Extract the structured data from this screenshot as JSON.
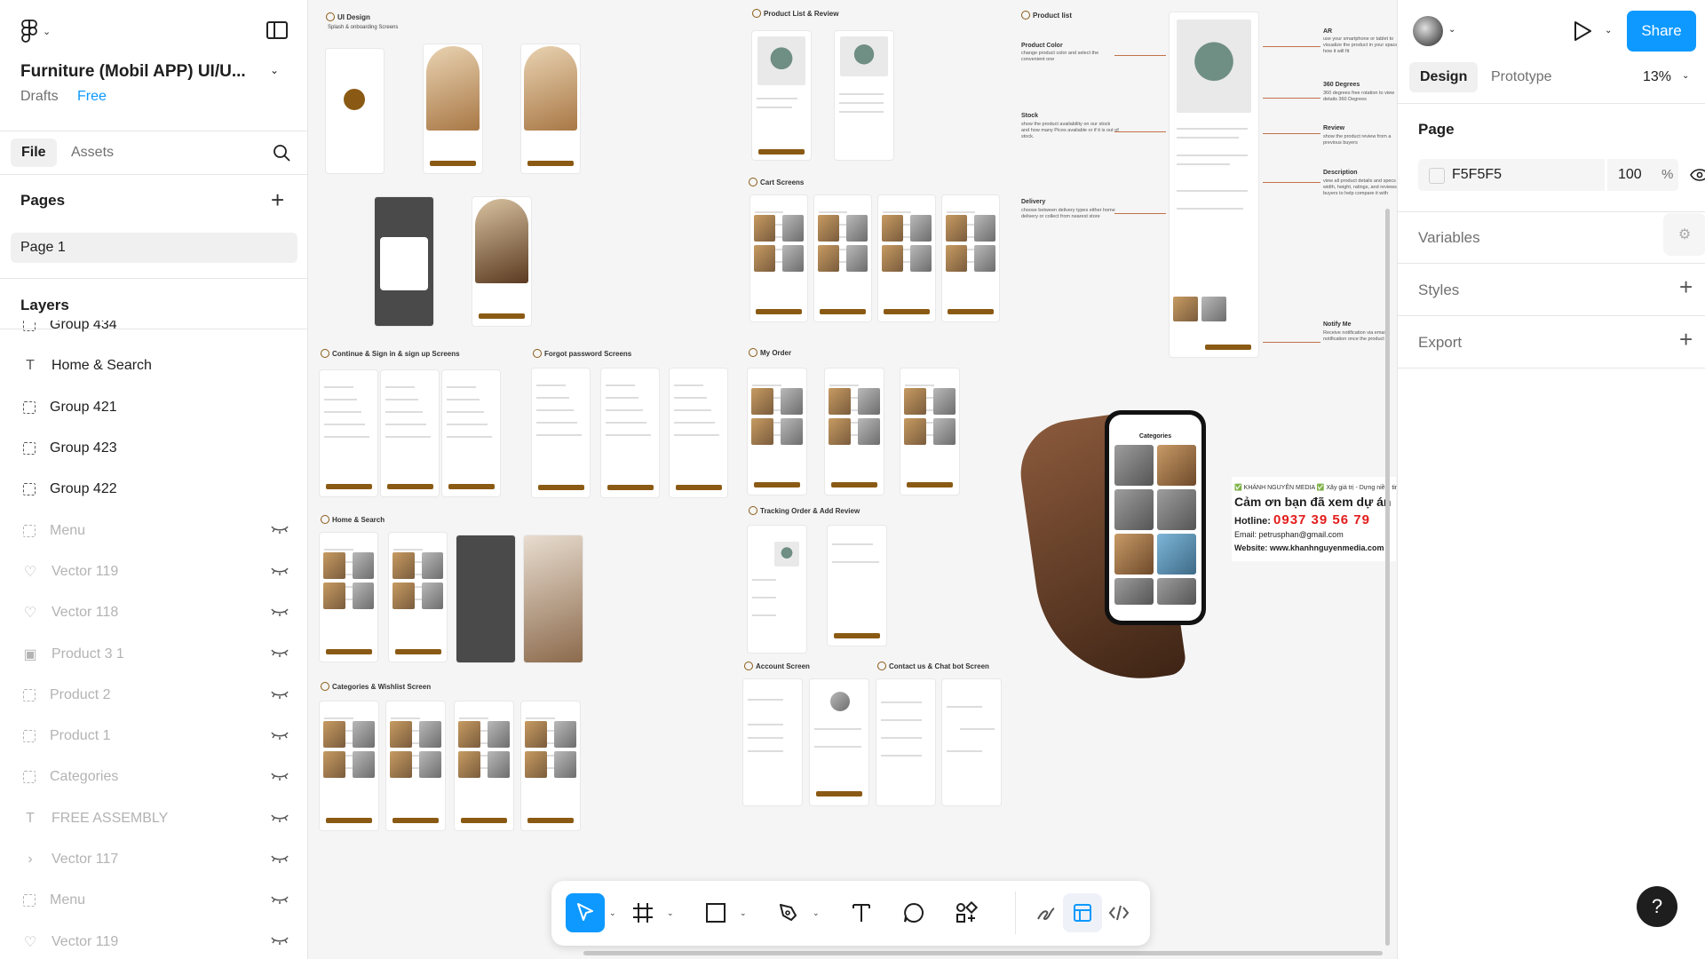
{
  "file": {
    "title": "Furniture (Mobil APP) UI/U...",
    "location": "Drafts",
    "plan": "Free"
  },
  "left_tabs": [
    "File",
    "Assets"
  ],
  "pages": {
    "header": "Pages",
    "items": [
      "Page 1"
    ]
  },
  "layers": {
    "header": "Layers",
    "items": [
      {
        "name": "Group 434",
        "type": "group",
        "hidden": false
      },
      {
        "name": "Home & Search",
        "type": "text",
        "hidden": false
      },
      {
        "name": "Group 421",
        "type": "group",
        "hidden": false
      },
      {
        "name": "Group 423",
        "type": "group",
        "hidden": false
      },
      {
        "name": "Group 422",
        "type": "group",
        "hidden": false
      },
      {
        "name": "Menu",
        "type": "group",
        "hidden": true
      },
      {
        "name": "Vector 119",
        "type": "vector",
        "hidden": true
      },
      {
        "name": "Vector 118",
        "type": "vector",
        "hidden": true
      },
      {
        "name": "Product 3 1",
        "type": "image",
        "hidden": true
      },
      {
        "name": "Product 2",
        "type": "group",
        "hidden": true
      },
      {
        "name": "Product 1",
        "type": "group",
        "hidden": true
      },
      {
        "name": "Categories",
        "type": "group",
        "hidden": true
      },
      {
        "name": "FREE ASSEMBLY",
        "type": "text",
        "hidden": true
      },
      {
        "name": "Vector 117",
        "type": "chevron",
        "hidden": true
      },
      {
        "name": "Menu",
        "type": "group",
        "hidden": true
      },
      {
        "name": "Vector 119",
        "type": "vector",
        "hidden": true
      }
    ]
  },
  "canvas": {
    "sections": {
      "ui_design": "UI Design",
      "ui_design_sub": "Splash & onboarding Screens",
      "product_list_review": "Product List & Review",
      "product_list": "Product list",
      "cart": "Cart Screens",
      "continue_sign": "Continue & Sign in & sign up Screens",
      "forgot": "Forgot password Screens",
      "my_order": "My Order",
      "home_search": "Home & Search",
      "tracking": "Tracking Order & Add Review",
      "categories": "Categories & Wishlist Screen",
      "account": "Account Screen",
      "contact": "Contact us & Chat bot Screen"
    },
    "annotations": [
      {
        "title": "Product Color",
        "text": "change product color and select the convenient one"
      },
      {
        "title": "Stock",
        "text": "show the product availability on our stock and how many Pices available or if it is out of stock."
      },
      {
        "title": "Delivery",
        "text": "choose between delivery types either home delivery or collect from nearest store"
      },
      {
        "title": "AR",
        "text": "use your smartphone or tablet to visualize the product in your space how it will fit"
      },
      {
        "title": "360 Degrees",
        "text": "360 degrees free rotation to view details 360 Degrees"
      },
      {
        "title": "Review",
        "text": "show the product review from a previous buyers"
      },
      {
        "title": "Description",
        "text": "view all product details and specs width, height, ratings, and reviews buyers to help compare it with"
      },
      {
        "title": "Notify Me",
        "text": "Receive notification via email, notification once the product is"
      }
    ],
    "phone": {
      "title": "Categories"
    },
    "promo": {
      "line1": "✅ KHÁNH NGUYÊN MEDIA ✅ Xây giá trị - Dựng niềm tin",
      "line2": "Cảm ơn bạn đã xem dự án",
      "hotline_label": "Hotline:",
      "hotline": "0937 39 56 79",
      "email": "Email:  petrusphan@gmail.com",
      "website": "Website: www.khanhnguyenmedia.com"
    }
  },
  "toolbar": {
    "tools": [
      "move",
      "frame",
      "shape",
      "pen",
      "text",
      "comment",
      "actions"
    ],
    "selected": "move"
  },
  "right": {
    "share_label": "Share",
    "tabs": [
      "Design",
      "Prototype"
    ],
    "zoom": "13%",
    "page_header": "Page",
    "page_color": "F5F5F5",
    "page_opacity": "100",
    "opacity_unit": "%",
    "variables": "Variables",
    "styles": "Styles",
    "export": "Export",
    "help": "?"
  },
  "colors": {
    "accent": "#0d99ff",
    "brand_brown": "#8a5a14",
    "canvas_bg": "#F5F5F5",
    "hotline_red": "#e31c1c"
  }
}
